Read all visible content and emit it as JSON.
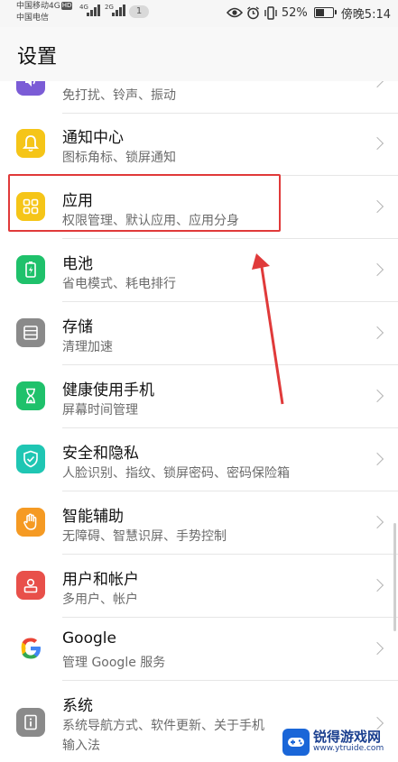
{
  "status_bar": {
    "carrier1": "中国移动4G",
    "hd": "HD",
    "carrier2": "中国电信",
    "net1": "4G",
    "net2": "2G",
    "notification_count": "1",
    "battery_percent": "52%",
    "battery_level": 0.52,
    "time": "傍晚5:14"
  },
  "header": {
    "title": "设置"
  },
  "items": [
    {
      "title": "",
      "subtitle": "免打扰、铃声、振动",
      "icon": "sound-icon",
      "color": "#7b5cd6"
    },
    {
      "title": "通知中心",
      "subtitle": "图标角标、锁屏通知",
      "icon": "bell-icon",
      "color": "#f5c518"
    },
    {
      "title": "应用",
      "subtitle": "权限管理、默认应用、应用分身",
      "icon": "apps-grid-icon",
      "color": "#f5c518"
    },
    {
      "title": "电池",
      "subtitle": "省电模式、耗电排行",
      "icon": "battery-icon",
      "color": "#1fc16b"
    },
    {
      "title": "存储",
      "subtitle": "清理加速",
      "icon": "storage-icon",
      "color": "#8a8a8a"
    },
    {
      "title": "健康使用手机",
      "subtitle": "屏幕时间管理",
      "icon": "hourglass-icon",
      "color": "#1fc16b"
    },
    {
      "title": "安全和隐私",
      "subtitle": "人脸识别、指纹、锁屏密码、密码保险箱",
      "icon": "shield-icon",
      "color": "#1fc6b3"
    },
    {
      "title": "智能辅助",
      "subtitle": "无障碍、智慧识屏、手势控制",
      "icon": "hand-icon",
      "color": "#f59a23"
    },
    {
      "title": "用户和帐户",
      "subtitle": "多用户、帐户",
      "icon": "user-icon",
      "color": "#e8504a"
    },
    {
      "title": "Google",
      "subtitle": "管理 Google 服务",
      "icon": "google-icon",
      "color": "#ffffff"
    },
    {
      "title": "系统",
      "subtitle": "系统导航方式、软件更新、关于手机",
      "subtitle2": "输入法",
      "icon": "info-icon",
      "color": "#8a8a8a"
    }
  ],
  "watermark": {
    "main": "锐得游戏网",
    "url": "www.ytruide.com"
  }
}
